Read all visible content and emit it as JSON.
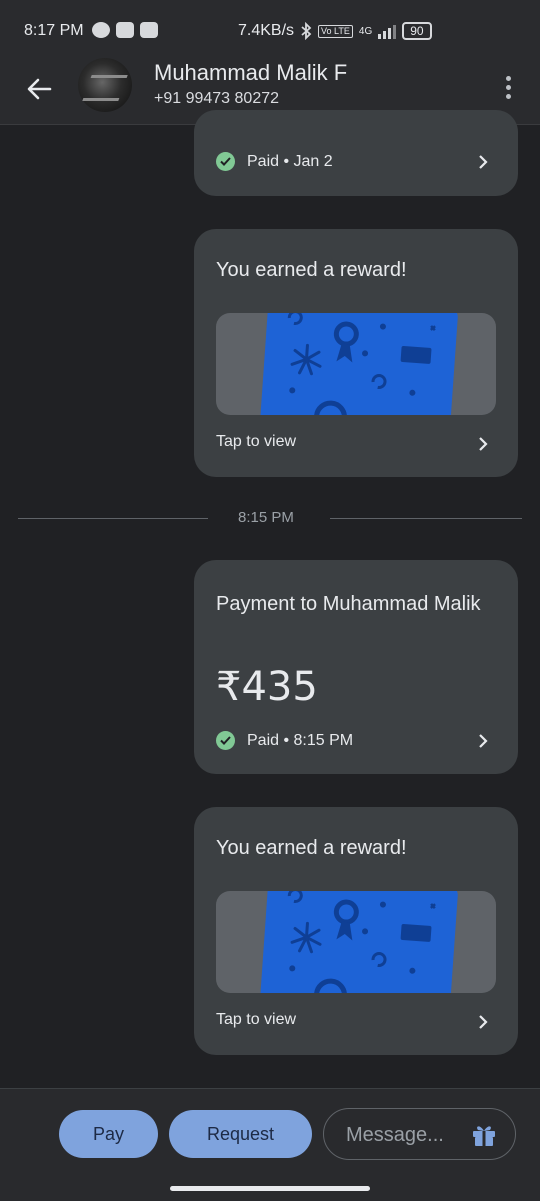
{
  "status_bar": {
    "time": "8:17 PM",
    "net_speed": "7.4KB/s",
    "network": "4G",
    "volte": "Vo LTE",
    "battery": "90"
  },
  "header": {
    "contact_name": "Muhammad Malik F",
    "phone": "+91 99473 80272"
  },
  "messages": {
    "prev_payment": {
      "status": "Paid • Jan 2"
    },
    "reward_1": {
      "title": "You earned a reward!",
      "action": "Tap to view"
    },
    "time_divider": "8:15 PM",
    "payment": {
      "title": "Payment to Muhammad Malik",
      "amount": "₹435",
      "status": "Paid • 8:15 PM"
    },
    "reward_2": {
      "title": "You earned a reward!",
      "action": "Tap to view"
    }
  },
  "bottom_bar": {
    "pay_label": "Pay",
    "request_label": "Request",
    "message_placeholder": "Message..."
  },
  "colors": {
    "background": "#202124",
    "card": "#3c4043",
    "accent_button": "#7fa3dd",
    "paid_check": "#81c995",
    "reward_card": "#1e63d6"
  }
}
